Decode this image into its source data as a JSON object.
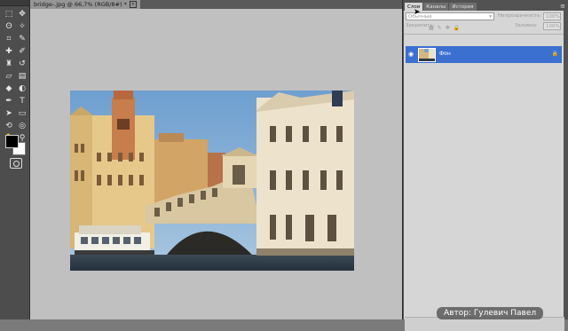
{
  "document": {
    "tab_title": "bridge-.jpg @ 66,7% (RGB/8#) *",
    "close_symbol": "×"
  },
  "toolbox": {
    "tools": [
      {
        "icon": "marquee-icon",
        "glyph": "⬚"
      },
      {
        "icon": "move-icon",
        "glyph": "✥"
      },
      {
        "icon": "lasso-icon",
        "glyph": "ʘ"
      },
      {
        "icon": "magic-wand-icon",
        "glyph": "✧"
      },
      {
        "icon": "crop-icon",
        "glyph": "⌗"
      },
      {
        "icon": "eyedropper-icon",
        "glyph": "✎"
      },
      {
        "icon": "healing-brush-icon",
        "glyph": "✚"
      },
      {
        "icon": "brush-icon",
        "glyph": "✐"
      },
      {
        "icon": "clone-stamp-icon",
        "glyph": "♜"
      },
      {
        "icon": "history-brush-icon",
        "glyph": "↺"
      },
      {
        "icon": "eraser-icon",
        "glyph": "▱"
      },
      {
        "icon": "gradient-icon",
        "glyph": "▤"
      },
      {
        "icon": "blur-icon",
        "glyph": "◆"
      },
      {
        "icon": "dodge-icon",
        "glyph": "◐"
      },
      {
        "icon": "pen-icon",
        "glyph": "✒"
      },
      {
        "icon": "type-icon",
        "glyph": "T"
      },
      {
        "icon": "path-selection-icon",
        "glyph": "➤"
      },
      {
        "icon": "shape-icon",
        "glyph": "▭"
      },
      {
        "icon": "3d-rotate-icon",
        "glyph": "⟲"
      },
      {
        "icon": "3d-camera-icon",
        "glyph": "◎"
      },
      {
        "icon": "hand-icon",
        "glyph": "✋"
      },
      {
        "icon": "zoom-icon",
        "glyph": "⚲"
      }
    ],
    "foreground_color": "#000000",
    "background_color": "#ffffff"
  },
  "panels": {
    "tabs": [
      {
        "label": "Слои",
        "active": true
      },
      {
        "label": "Каналы",
        "active": false
      },
      {
        "label": "История",
        "active": false
      }
    ],
    "menu_glyph": "≡",
    "blend_mode": "Обычные",
    "opacity_label": "Непрозрачность:",
    "opacity_value": "100%",
    "lock_label": "Закрепить:",
    "fill_label": "Заливка:",
    "fill_value": "100%",
    "layer": {
      "name": "Фон",
      "eye_glyph": "👁",
      "lock_glyph": "🔒"
    }
  },
  "watermark": "Автор: Гулевич Павел",
  "colors": {
    "canvas_bg": "#c0c0c0",
    "app_dark": "#4d4d4d",
    "panel_bg": "#d6d6d6",
    "selected_layer": "#3b6fd0"
  }
}
